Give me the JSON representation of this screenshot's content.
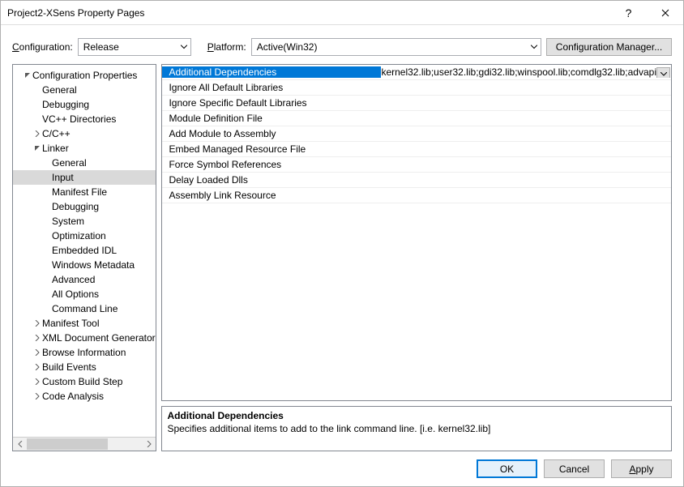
{
  "window": {
    "title": "Project2-XSens Property Pages"
  },
  "config": {
    "configuration_label": "onfiguration:",
    "configuration_value": "Release",
    "platform_label": "latform:",
    "platform_value": "Active(Win32)",
    "config_manager": "Configuration Manager..."
  },
  "tree": {
    "root": "Configuration Properties",
    "l1": {
      "general": "General",
      "debugging": "Debugging",
      "vcpp": "VC++ Directories",
      "ccpp": "C/C++",
      "linker": "Linker"
    },
    "linker": {
      "general": "General",
      "input": "Input",
      "manifest_file": "Manifest File",
      "debugging": "Debugging",
      "system": "System",
      "optimization": "Optimization",
      "embedded_idl": "Embedded IDL",
      "win_metadata": "Windows Metadata",
      "advanced": "Advanced",
      "all_options": "All Options",
      "command_line": "Command Line"
    },
    "after": {
      "manifest_tool": "Manifest Tool",
      "xml_doc": "XML Document Generator",
      "browse_info": "Browse Information",
      "build_events": "Build Events",
      "custom_build": "Custom Build Step",
      "code_analysis": "Code Analysis"
    }
  },
  "props": {
    "rows": [
      {
        "name": "Additional Dependencies",
        "value": "kernel32.lib;user32.lib;gdi32.lib;winspool.lib;comdlg32.lib;advapi"
      },
      {
        "name": "Ignore All Default Libraries",
        "value": ""
      },
      {
        "name": "Ignore Specific Default Libraries",
        "value": ""
      },
      {
        "name": "Module Definition File",
        "value": ""
      },
      {
        "name": "Add Module to Assembly",
        "value": ""
      },
      {
        "name": "Embed Managed Resource File",
        "value": ""
      },
      {
        "name": "Force Symbol References",
        "value": ""
      },
      {
        "name": "Delay Loaded Dlls",
        "value": ""
      },
      {
        "name": "Assembly Link Resource",
        "value": ""
      }
    ]
  },
  "desc": {
    "title": "Additional Dependencies",
    "text": "Specifies additional items to add to the link command line. [i.e. kernel32.lib]"
  },
  "buttons": {
    "ok": "OK",
    "cancel": "Cancel",
    "apply": "Apply"
  }
}
